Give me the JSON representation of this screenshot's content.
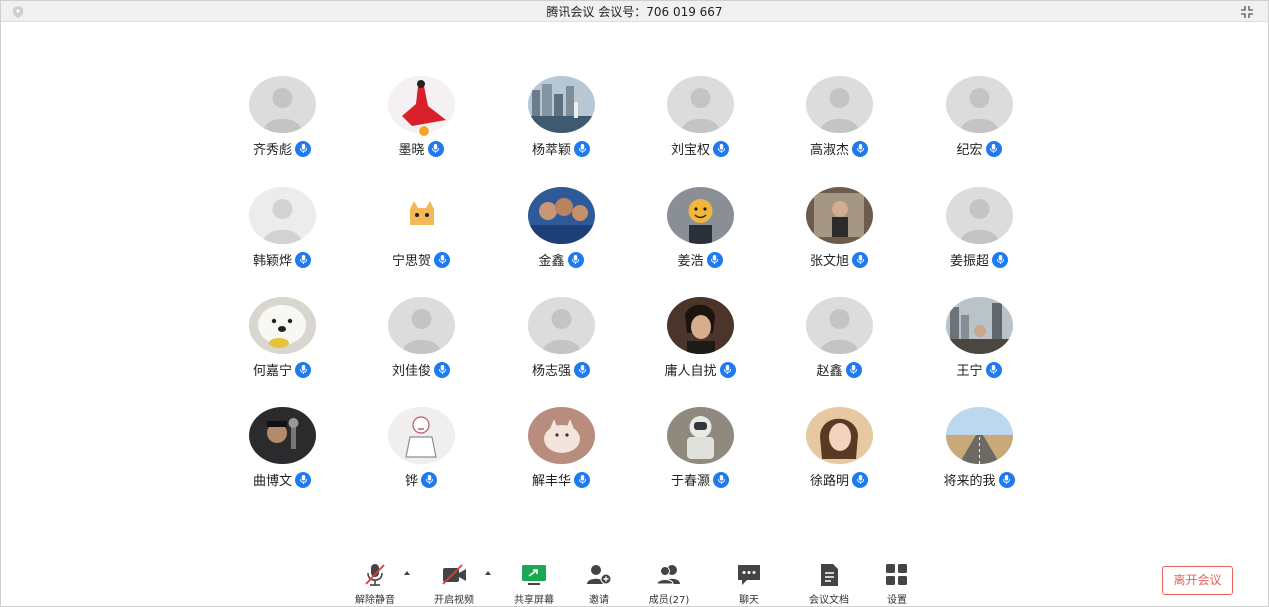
{
  "window": {
    "title": "腾讯会议 会议号：706 019 667"
  },
  "participants": [
    {
      "name": "齐秀彪",
      "avatar": "default-gray"
    },
    {
      "name": "墨晓",
      "avatar": "red-dress-photo",
      "host": true
    },
    {
      "name": "杨萃颖",
      "avatar": "city-photo"
    },
    {
      "name": "刘宝权",
      "avatar": "default-gray"
    },
    {
      "name": "高淑杰",
      "avatar": "default-gray"
    },
    {
      "name": "纪宏",
      "avatar": "default-gray"
    },
    {
      "name": "韩颖烨",
      "avatar": "default-light"
    },
    {
      "name": "宁思贺",
      "avatar": "cat-cartoon"
    },
    {
      "name": "金鑫",
      "avatar": "group-selfie-photo"
    },
    {
      "name": "姜浩",
      "avatar": "smiley-figure"
    },
    {
      "name": "张文旭",
      "avatar": "mirror-selfie-photo"
    },
    {
      "name": "姜振超",
      "avatar": "default-gray"
    },
    {
      "name": "何嘉宁",
      "avatar": "white-dog-photo"
    },
    {
      "name": "刘佳俊",
      "avatar": "default-gray"
    },
    {
      "name": "杨志强",
      "avatar": "default-gray"
    },
    {
      "name": "庸人自扰",
      "avatar": "portrait-dark-photo"
    },
    {
      "name": "赵鑫",
      "avatar": "default-gray"
    },
    {
      "name": "王宁",
      "avatar": "cityscape-photo"
    },
    {
      "name": "曲博文",
      "avatar": "microphone-photo"
    },
    {
      "name": "铧",
      "avatar": "anime-sketch"
    },
    {
      "name": "解丰华",
      "avatar": "cat-photo"
    },
    {
      "name": "于春灏",
      "avatar": "astronaut-photo"
    },
    {
      "name": "徐路明",
      "avatar": "girl-portrait-photo"
    },
    {
      "name": "将来的我",
      "avatar": "road-sky-photo"
    }
  ],
  "toolbar": {
    "unmute": "解除静音",
    "start_video": "开启视频",
    "share_screen": "共享屏幕",
    "invite": "邀请",
    "members": "成员(27)",
    "chat": "聊天",
    "docs": "会议文档",
    "settings": "设置",
    "leave": "离开会议"
  },
  "colors": {
    "mic_blue": "#1f7af0",
    "leave_red": "#e8605a",
    "share_green": "#1aa853"
  },
  "icons": {
    "mic": "microphone-icon",
    "mic_muted": "microphone-muted-icon",
    "video_off": "video-off-icon",
    "share": "share-screen-icon",
    "invite": "add-person-icon",
    "members": "people-icon",
    "chat": "chat-bubble-icon",
    "docs": "document-icon",
    "settings": "grid-settings-icon"
  }
}
